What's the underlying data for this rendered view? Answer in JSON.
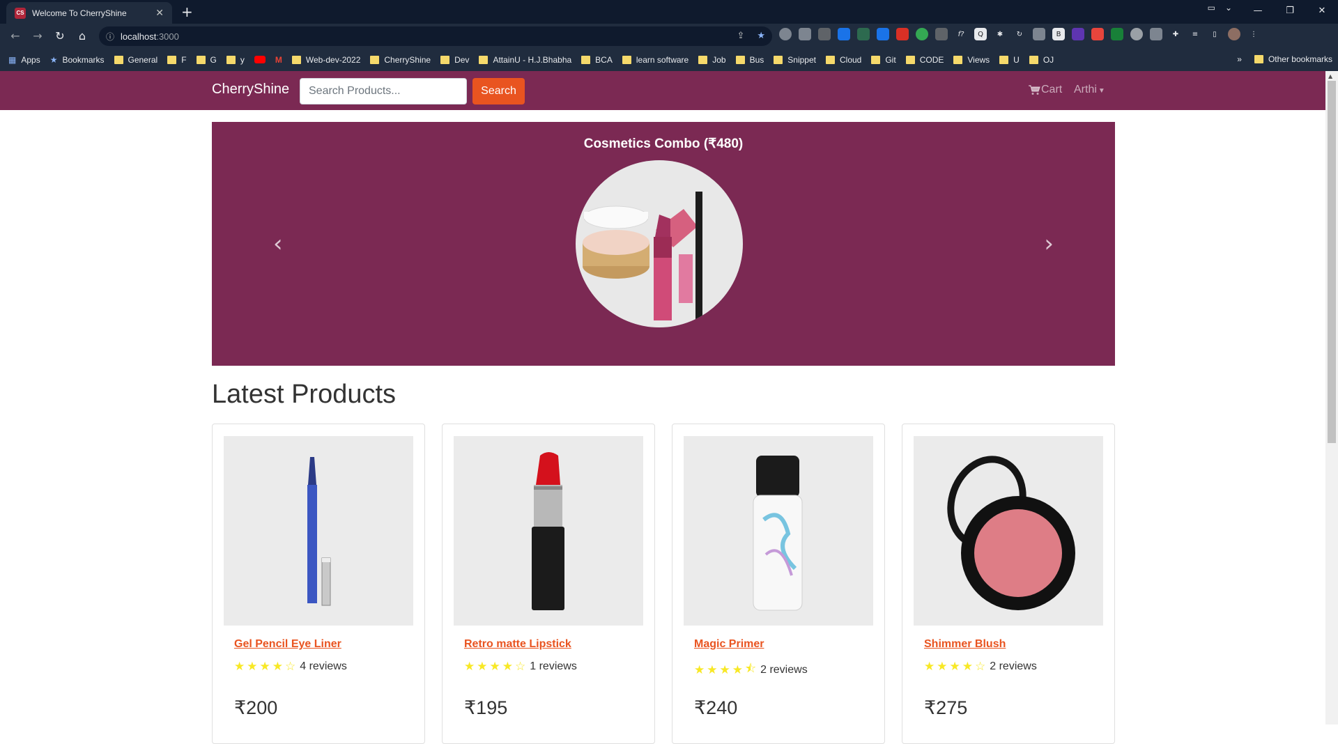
{
  "browser": {
    "tab_title": "Welcome To CherryShine",
    "tab_favicon": "CS",
    "url_host": "localhost",
    "url_port": ":3000",
    "bookmarks": [
      "Apps",
      "Bookmarks",
      "General",
      "F",
      "G",
      "y",
      "",
      "Web-dev-2022",
      "CherryShine",
      "Dev",
      "AttainU - H.J.Bhabha",
      "BCA",
      "learn software",
      "Job",
      "Bus",
      "Snippet",
      "Cloud",
      "Git",
      "CODE",
      "Views",
      "U",
      "OJ"
    ],
    "other_bookmarks": "Other bookmarks"
  },
  "navbar": {
    "brand": "CherryShine",
    "search_placeholder": "Search Products...",
    "search_button": "Search",
    "cart_label": "Cart",
    "user_label": "Arthi"
  },
  "carousel": {
    "caption": "Cosmetics Combo (₹480)"
  },
  "section": {
    "title": "Latest Products"
  },
  "products": [
    {
      "name": "Gel Pencil Eye Liner",
      "rating": 4,
      "reviews": "4 reviews",
      "price": "₹200"
    },
    {
      "name": "Retro matte Lipstick",
      "rating": 4,
      "reviews": "1 reviews",
      "price": "₹195"
    },
    {
      "name": "Magic Primer",
      "rating": 4.5,
      "reviews": "2 reviews",
      "price": "₹240"
    },
    {
      "name": "Shimmer Blush",
      "rating": 4,
      "reviews": "2 reviews",
      "price": "₹275"
    }
  ],
  "colors": {
    "brand": "#7b2953",
    "accent": "#e95420",
    "star": "#f8e825"
  }
}
